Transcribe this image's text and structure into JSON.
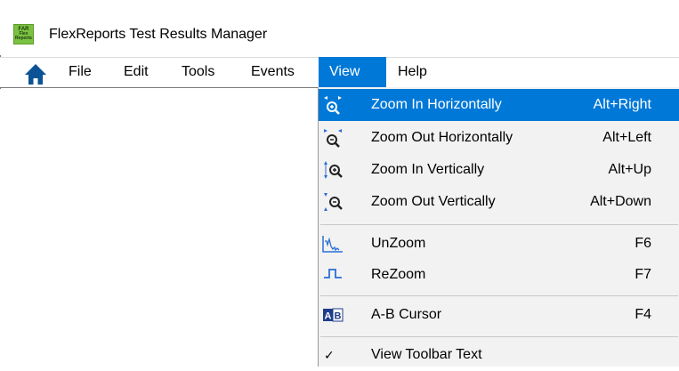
{
  "app": {
    "title": "FlexReports Test Results Manager",
    "logo_text_1": "FAR",
    "logo_text_2": "Flex",
    "logo_text_3": "Reports"
  },
  "colors": {
    "accent": "#0078d7",
    "logo_green": "#7cc242",
    "home_icon": "#0b5394"
  },
  "menubar": {
    "items": [
      {
        "label": "File"
      },
      {
        "label": "Edit"
      },
      {
        "label": "Tools"
      },
      {
        "label": "Events"
      },
      {
        "label": "View"
      },
      {
        "label": "Help"
      }
    ],
    "active": "View",
    "home_icon": "home-icon"
  },
  "view_menu": {
    "items": [
      {
        "label": "Zoom In Horizontally",
        "shortcut": "Alt+Right",
        "icon": "zoom-in-horizontal-icon",
        "highlighted": true
      },
      {
        "label": "Zoom Out Horizontally",
        "shortcut": "Alt+Left",
        "icon": "zoom-out-horizontal-icon"
      },
      {
        "label": "Zoom In Vertically",
        "shortcut": "Alt+Up",
        "icon": "zoom-in-vertical-icon"
      },
      {
        "label": "Zoom Out Vertically",
        "shortcut": "Alt+Down",
        "icon": "zoom-out-vertical-icon"
      },
      {
        "label": "UnZoom",
        "shortcut": "F6",
        "icon": "unzoom-icon"
      },
      {
        "label": "ReZoom",
        "shortcut": "F7",
        "icon": "rezoom-icon"
      },
      {
        "label": "A-B Cursor",
        "shortcut": "F4",
        "icon": "ab-cursor-icon"
      },
      {
        "label": "View Toolbar Text",
        "shortcut": "",
        "icon": "check-icon",
        "checked": true
      }
    ],
    "ab_icon_a": "A",
    "ab_icon_b": "B",
    "check_glyph": "✓"
  }
}
